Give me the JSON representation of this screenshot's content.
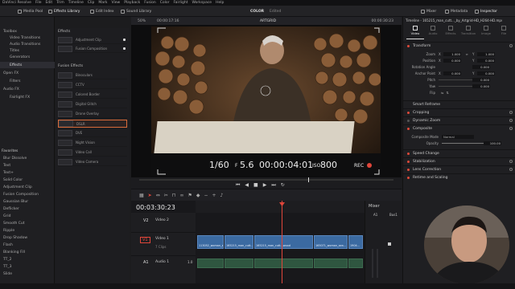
{
  "menu": [
    "DaVinci Resolve",
    "File",
    "Edit",
    "Trim",
    "Timeline",
    "Clip",
    "Mark",
    "View",
    "Playback",
    "Fusion",
    "Color",
    "Fairlight",
    "Workspace",
    "Help"
  ],
  "toolbar": {
    "media_pool": "Media Pool",
    "effects_library": "Effects Library",
    "edit_index": "Edit Index",
    "sound_library": "Sound Library",
    "project_title": "COLOR",
    "project_state": "Edited",
    "mixer": "Mixer",
    "metadata": "Metadata",
    "inspector": "Inspector"
  },
  "left_tree": {
    "toolbox": "Toolbox",
    "video_transitions": "Video Transitions",
    "audio_transitions": "Audio Transitions",
    "titles": "Titles",
    "generators": "Generators",
    "effects": "Effects",
    "open_fx": "Open FX",
    "filters": "Filters",
    "audio_fx": "Audio FX",
    "fairlight_fx": "Fairlight FX"
  },
  "favorites": {
    "heading": "Favorites",
    "items": [
      "Blur Dissolve",
      "Text",
      "Text+",
      "Solid Color",
      "Adjustment Clip",
      "Fusion Composition",
      "Gaussian Blur",
      "Deflicker",
      "Grid",
      "Smooth Cut",
      "Ripple",
      "Drop Shadow",
      "Flash",
      "Blanking Fill",
      "TT_2",
      "TT_3",
      "Slide"
    ]
  },
  "effects_panel": {
    "section1": "Effects",
    "items1": [
      "Adjustment Clip",
      "Fusion Composition"
    ],
    "section2": "Fusion Effects",
    "items2": [
      "Binoculars",
      "CCTV",
      "Colored Border",
      "Digital Glitch",
      "Drone Overlay",
      "DSLR",
      "DVE",
      "Night Vision",
      "Video Call",
      "Video Camera"
    ],
    "selected": "DSLR"
  },
  "viewer": {
    "zoom": "50%",
    "timecode_top": "00:00:17:16",
    "clip_name": "ARTGRID",
    "timecode_right": "00:00:30:23",
    "overlay": {
      "shutter": "1/60",
      "aperture_prefix": "F",
      "aperture": "5.6",
      "timecode": "00:00:04:01",
      "iso_prefix": "ISO",
      "iso": "800",
      "rec": "REC"
    }
  },
  "inspector": {
    "file_title": "Timeline - 165215_man_cutt..._by_Artgrid-HD_H264-HD.mp4",
    "tabs": [
      "Video",
      "Audio",
      "Effects",
      "Transition",
      "Image",
      "File"
    ],
    "transform": "Transform",
    "zoom_label": "Zoom",
    "zoom_x": "1.000",
    "zoom_y": "1.000",
    "position_label": "Position",
    "position_x": "0.000",
    "position_y": "0.000",
    "rotation_label": "Rotation Angle",
    "rotation": "0.000",
    "anchor_label": "Anchor Point",
    "anchor_x": "0.000",
    "anchor_y": "0.000",
    "pitch_label": "Pitch",
    "pitch": "0.000",
    "yaw_label": "Yaw",
    "yaw": "0.000",
    "flip_label": "Flip",
    "smart_reframe": "Smart Reframe",
    "cropping": "Cropping",
    "dynamic_zoom": "Dynamic Zoom",
    "composite": "Composite",
    "composite_mode_label": "Composite Mode",
    "composite_mode": "Normal",
    "opacity_label": "Opacity",
    "opacity": "100.00",
    "speed_change": "Speed Change",
    "stabilization": "Stabilization",
    "lens_correction": "Lens Correction",
    "retime_scaling": "Retime and Scaling"
  },
  "timeline": {
    "timecode": "00:03:30:23",
    "tracks": [
      {
        "id": "V2",
        "name": "Video 2",
        "clips": ""
      },
      {
        "id": "V1",
        "name": "Video 1",
        "clips": "7 Clips"
      },
      {
        "id": "A1",
        "name": "Audio 1",
        "level": "1.0"
      }
    ],
    "clips": [
      "113052_woman_sea...",
      "165215_man_cutt...",
      "165215_man_cutt...wood",
      "165071_woman_sea...",
      "1904..."
    ]
  },
  "mixer": {
    "title": "Mixer",
    "a1": "A1",
    "bus": "Bus1"
  },
  "colors": {
    "accent": "#d96b3a",
    "clip_blue": "#3b6aa1",
    "playhead": "#e0463a"
  }
}
